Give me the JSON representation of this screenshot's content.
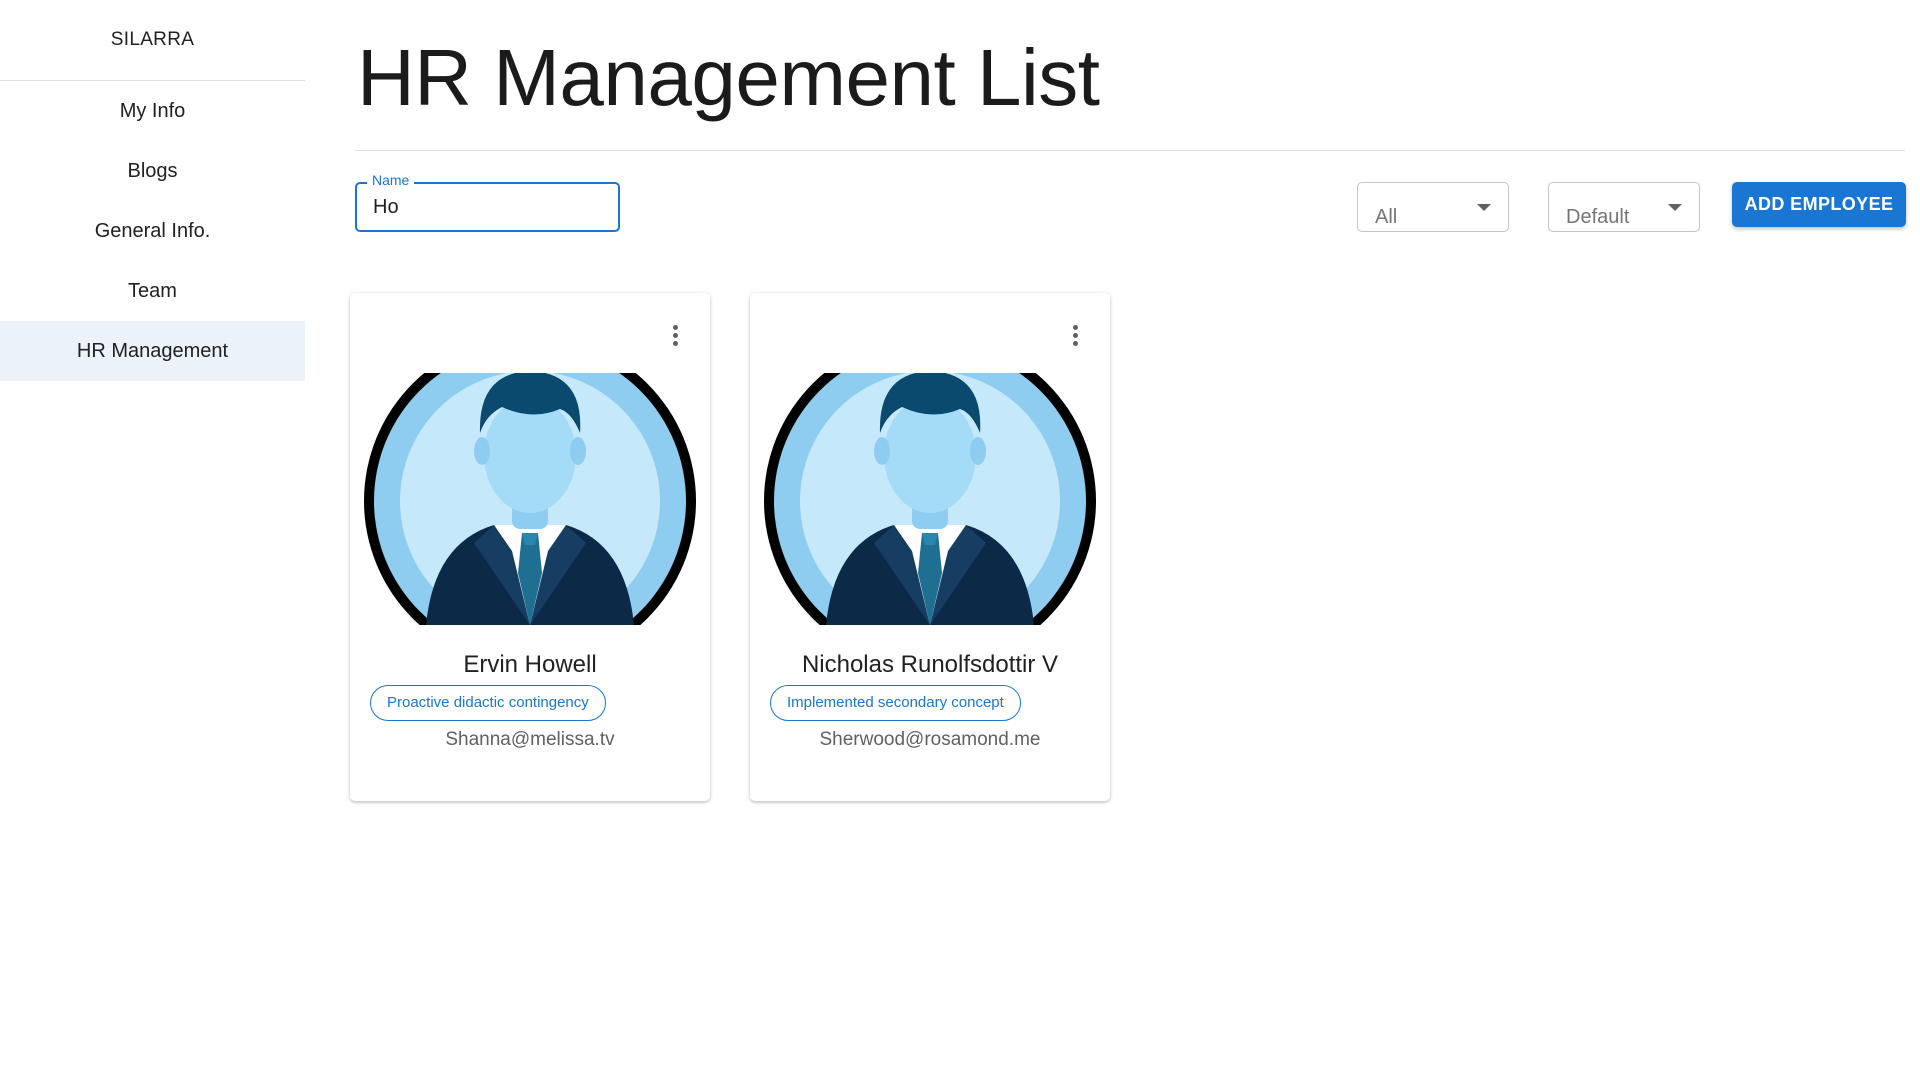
{
  "sidebar": {
    "brand": "SILARRA",
    "items": [
      {
        "label": "My Info"
      },
      {
        "label": "Blogs"
      },
      {
        "label": "General Info."
      },
      {
        "label": "Team"
      },
      {
        "label": "HR Management",
        "active": true
      }
    ]
  },
  "main": {
    "title": "HR Management List",
    "filters": {
      "name_label": "Name",
      "name_value": "Ho",
      "status_value": "All",
      "sort_value": "Default",
      "add_button": "ADD EMPLOYEE"
    },
    "employees": [
      {
        "name": "Ervin Howell",
        "tag": "Proactive didactic contingency",
        "email": "Shanna@melissa.tv"
      },
      {
        "name": "Nicholas Runolfsdottir V",
        "tag": "Implemented secondary concept",
        "email": "Sherwood@rosamond.me"
      }
    ]
  },
  "colors": {
    "accent": "#1976d2",
    "active_nav_bg": "#ecf2fa",
    "avatar_ring": "#8ecdef",
    "avatar_inner": "#c5e8fb",
    "suit": "#0c2a47",
    "hair": "#0a4a6e"
  },
  "icons": {
    "card_menu": "more-vert-icon",
    "select_caret": "arrow-drop-down-icon",
    "avatar": "businessman-avatar-icon"
  }
}
